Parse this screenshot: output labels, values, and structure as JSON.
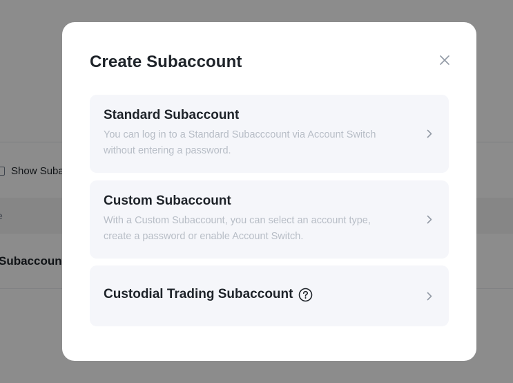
{
  "background": {
    "show_label": "Show Suba",
    "table_header_fragment": "e",
    "row_fragment": "Subaccount"
  },
  "modal": {
    "title": "Create Subaccount",
    "close_icon": "close-icon",
    "options": [
      {
        "title": "Standard Subaccount",
        "description": "You can log in to a Standard Subacccount via Account Switch without entering a password.",
        "icon": "chevron-right-icon"
      },
      {
        "title": "Custom Subaccount",
        "description": "With a Custom Subaccount, you can select an account type, create a password or enable Account Switch.",
        "icon": "chevron-right-icon"
      },
      {
        "title": "Custodial Trading Subaccount",
        "description": "",
        "icon": "chevron-right-icon",
        "help_icon": "question-circle-icon"
      }
    ]
  },
  "colors": {
    "text_primary": "#1e2329",
    "text_secondary": "#b7bdc6",
    "card_bg": "#f5f6fa",
    "overlay": "rgba(0,0,0,0.45)"
  }
}
